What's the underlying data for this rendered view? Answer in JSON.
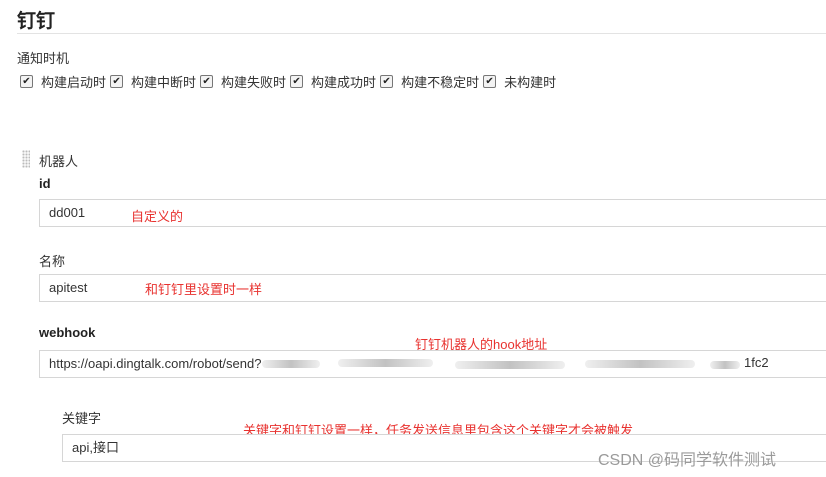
{
  "header": {
    "title": "钉钉"
  },
  "notify": {
    "label": "通知时机",
    "options": [
      {
        "label": "构建启动时",
        "checked": true
      },
      {
        "label": "构建中断时",
        "checked": true
      },
      {
        "label": "构建失败时",
        "checked": true
      },
      {
        "label": "构建成功时",
        "checked": true
      },
      {
        "label": "构建不稳定时",
        "checked": true
      },
      {
        "label": "未构建时",
        "checked": true
      }
    ]
  },
  "robot": {
    "label": "机器人",
    "id": {
      "label": "id",
      "value": "dd001",
      "note": "自定义的"
    },
    "name": {
      "label": "名称",
      "value": "apitest",
      "note": "和钉钉里设置时一样"
    },
    "webhook": {
      "label": "webhook",
      "value_start": "https://oapi.dingtalk.com/robot/send?",
      "value_end": "1fc2",
      "note": "钉钉机器人的hook地址"
    },
    "keyword": {
      "label": "关键字",
      "value": "api,接口",
      "note": "关键字和钉钉设置一样，任务发送信息里包含这个关键字才会被触发"
    }
  },
  "watermark": "CSDN @码同学软件测试"
}
